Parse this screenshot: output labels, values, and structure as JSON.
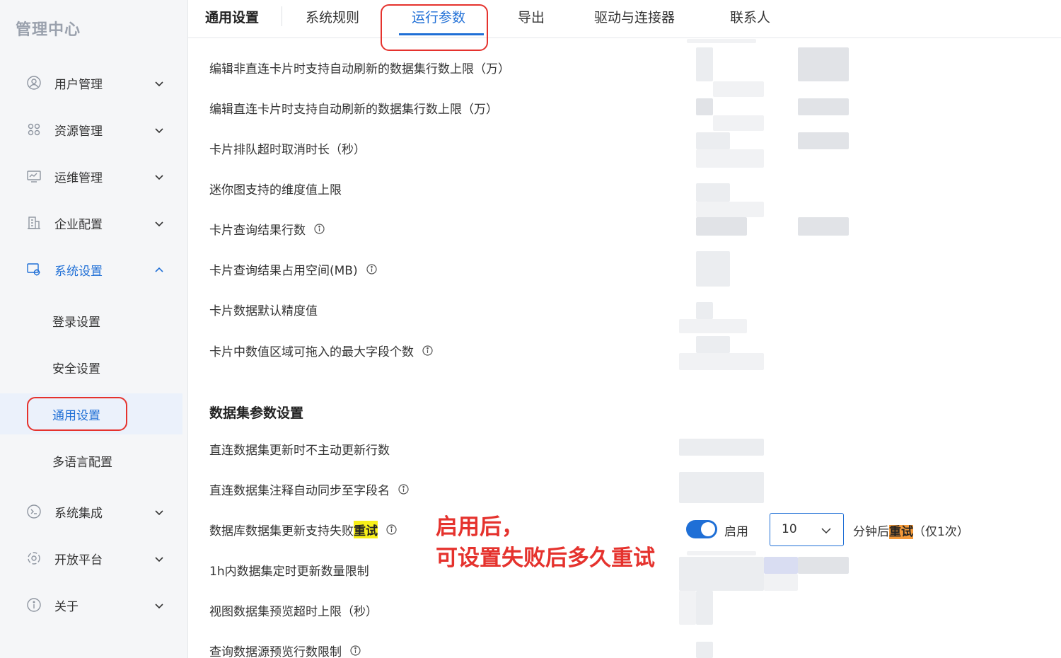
{
  "app_title": "管理中心",
  "sidebar": {
    "items": [
      {
        "label": "用户管理",
        "icon": "user-circle-icon"
      },
      {
        "label": "资源管理",
        "icon": "grid-icon"
      },
      {
        "label": "运维管理",
        "icon": "monitor-icon"
      },
      {
        "label": "企业配置",
        "icon": "building-icon"
      },
      {
        "label": "系统设置",
        "icon": "settings-icon"
      },
      {
        "label": "系统集成",
        "icon": "integration-icon"
      },
      {
        "label": "开放平台",
        "icon": "platform-icon"
      },
      {
        "label": "关于",
        "icon": "info-icon"
      }
    ],
    "sub_items": [
      {
        "label": "登录设置"
      },
      {
        "label": "安全设置"
      },
      {
        "label": "通用设置"
      },
      {
        "label": "多语言配置"
      }
    ]
  },
  "tabs": [
    {
      "label": "通用设置"
    },
    {
      "label": "系统规则"
    },
    {
      "label": "运行参数"
    },
    {
      "label": "导出"
    },
    {
      "label": "驱动与连接器"
    },
    {
      "label": "联系人"
    }
  ],
  "rows": [
    {
      "label": "编辑非直连卡片时支持自动刷新的数据集行数上限（万）"
    },
    {
      "label": "编辑直连卡片时支持自动刷新的数据集行数上限（万）"
    },
    {
      "label": "卡片排队超时取消时长（秒）"
    },
    {
      "label": "迷你图支持的维度值上限"
    },
    {
      "label": "卡片查询结果行数"
    },
    {
      "label": "卡片查询结果占用空间(MB)"
    },
    {
      "label": "卡片数据默认精度值"
    },
    {
      "label": "卡片中数值区域可拖入的最大字段个数"
    }
  ],
  "section_title": "数据集参数设置",
  "dataset_rows": [
    {
      "label": "直连数据集更新时不主动更新行数"
    },
    {
      "label": "直连数据集注释自动同步至字段名"
    },
    {
      "label_pre": "数据库数据集更新支持失败",
      "label_hl": "重试"
    },
    {
      "label": "1h内数据集定时更新数量限制"
    },
    {
      "label": "视图数据集预览超时上限（秒）"
    },
    {
      "label": "查询数据源预览行数限制"
    }
  ],
  "retry": {
    "toggle_label": "启用",
    "select_value": "10",
    "suffix_pre": "分钟后",
    "suffix_hl": "重试",
    "suffix_post": "（仅1次）"
  },
  "annotation": {
    "line1": "启用后，",
    "line2": "可设置失败后多久重试"
  },
  "colors": {
    "accent": "#1f6fd6",
    "annotation": "#e5322d",
    "highlight_yellow": "#f7ef1a",
    "highlight_orange": "#f49a3a"
  }
}
